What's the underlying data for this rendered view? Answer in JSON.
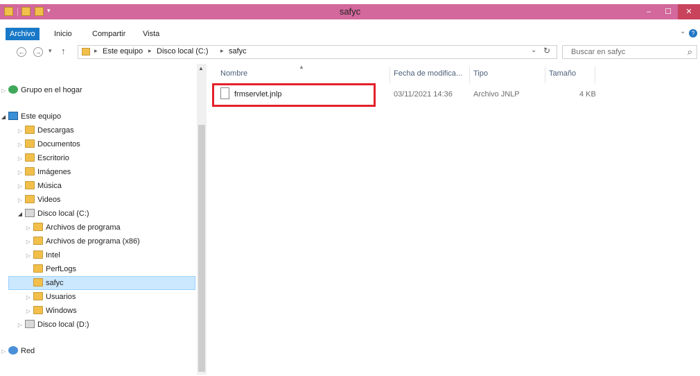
{
  "window": {
    "title": "safyc",
    "minimize_glyph": "‒",
    "maximize_glyph": "☐",
    "close_glyph": "✕"
  },
  "ribbon": {
    "tabs": [
      "Archivo",
      "Inicio",
      "Compartir",
      "Vista"
    ],
    "help_glyph": "?",
    "expand_glyph": "⌄"
  },
  "address": {
    "back_glyph": "←",
    "forward_glyph": "→",
    "recent_glyph": "▾",
    "up_glyph": "↑",
    "breadcrumb": [
      "Este equipo",
      "Disco local (C:)",
      "safyc"
    ],
    "dropdown_glyph": "⌄",
    "refresh_glyph": "↻",
    "search_placeholder": "Buscar en safyc",
    "search_glyph": "⌕"
  },
  "sidebar": {
    "items": [
      {
        "label": "Grupo en el hogar",
        "icon": "homegroup-icon",
        "level": 0,
        "state": "collapsed"
      },
      {
        "label": "Este equipo",
        "icon": "computer-icon",
        "level": 0,
        "state": "expanded"
      },
      {
        "label": "Descargas",
        "icon": "downloads-folder-icon",
        "level": 1,
        "state": "collapsed"
      },
      {
        "label": "Documentos",
        "icon": "documents-folder-icon",
        "level": 1,
        "state": "collapsed"
      },
      {
        "label": "Escritorio",
        "icon": "desktop-folder-icon",
        "level": 1,
        "state": "collapsed"
      },
      {
        "label": "Imágenes",
        "icon": "pictures-folder-icon",
        "level": 1,
        "state": "collapsed"
      },
      {
        "label": "Música",
        "icon": "music-folder-icon",
        "level": 1,
        "state": "collapsed"
      },
      {
        "label": "Videos",
        "icon": "videos-folder-icon",
        "level": 1,
        "state": "collapsed"
      },
      {
        "label": "Disco local (C:)",
        "icon": "local-disk-icon",
        "level": 1,
        "state": "expanded"
      },
      {
        "label": "Archivos de programa",
        "icon": "folder-icon",
        "level": 2,
        "state": "collapsed"
      },
      {
        "label": "Archivos de programa (x86)",
        "icon": "folder-icon",
        "level": 2,
        "state": "collapsed"
      },
      {
        "label": "Intel",
        "icon": "folder-icon",
        "level": 2,
        "state": "collapsed"
      },
      {
        "label": "PerfLogs",
        "icon": "folder-icon",
        "level": 2,
        "state": "none"
      },
      {
        "label": "safyc",
        "icon": "folder-icon",
        "level": 2,
        "state": "none",
        "selected": true
      },
      {
        "label": "Usuarios",
        "icon": "folder-icon",
        "level": 2,
        "state": "collapsed"
      },
      {
        "label": "Windows",
        "icon": "folder-icon",
        "level": 2,
        "state": "collapsed"
      },
      {
        "label": "Disco local (D:)",
        "icon": "local-disk-icon",
        "level": 1,
        "state": "collapsed"
      },
      {
        "label": "Red",
        "icon": "network-icon",
        "level": 0,
        "state": "collapsed"
      }
    ]
  },
  "filelist": {
    "columns": [
      "Nombre",
      "Fecha de modifica...",
      "Tipo",
      "Tamaño"
    ],
    "sort_glyph": "▲",
    "files": [
      {
        "name": "frmservlet.jnlp",
        "date": "03/11/2021 14:36",
        "type": "Archivo JNLP",
        "size": "4 KB"
      }
    ]
  },
  "colors": {
    "titlebar": "#d2689b",
    "accent": "#1979c8",
    "highlight_border": "#e3202a",
    "selection": "#cce8ff"
  }
}
